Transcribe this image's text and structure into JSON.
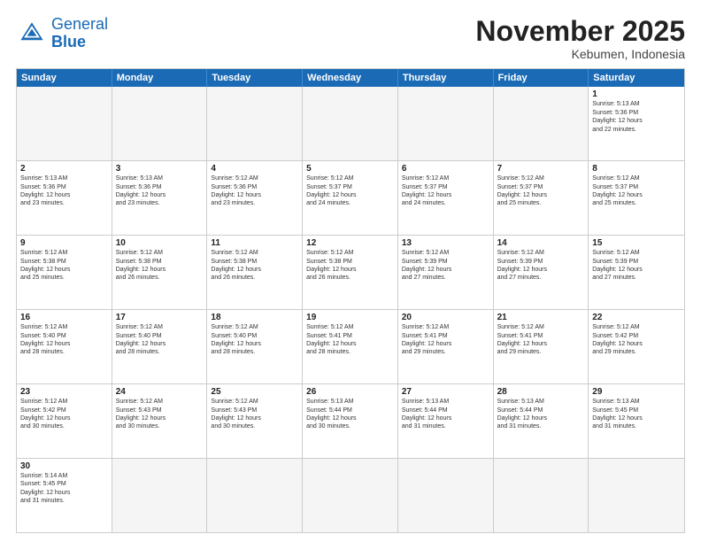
{
  "header": {
    "logo_general": "General",
    "logo_blue": "Blue",
    "title": "November 2025",
    "subtitle": "Kebumen, Indonesia"
  },
  "weekdays": [
    "Sunday",
    "Monday",
    "Tuesday",
    "Wednesday",
    "Thursday",
    "Friday",
    "Saturday"
  ],
  "rows": [
    [
      {
        "day": "",
        "info": "",
        "empty": true
      },
      {
        "day": "",
        "info": "",
        "empty": true
      },
      {
        "day": "",
        "info": "",
        "empty": true
      },
      {
        "day": "",
        "info": "",
        "empty": true
      },
      {
        "day": "",
        "info": "",
        "empty": true
      },
      {
        "day": "",
        "info": "",
        "empty": true
      },
      {
        "day": "1",
        "info": "Sunrise: 5:13 AM\nSunset: 5:36 PM\nDaylight: 12 hours\nand 22 minutes.",
        "empty": false
      }
    ],
    [
      {
        "day": "2",
        "info": "Sunrise: 5:13 AM\nSunset: 5:36 PM\nDaylight: 12 hours\nand 23 minutes.",
        "empty": false
      },
      {
        "day": "3",
        "info": "Sunrise: 5:13 AM\nSunset: 5:36 PM\nDaylight: 12 hours\nand 23 minutes.",
        "empty": false
      },
      {
        "day": "4",
        "info": "Sunrise: 5:12 AM\nSunset: 5:36 PM\nDaylight: 12 hours\nand 23 minutes.",
        "empty": false
      },
      {
        "day": "5",
        "info": "Sunrise: 5:12 AM\nSunset: 5:37 PM\nDaylight: 12 hours\nand 24 minutes.",
        "empty": false
      },
      {
        "day": "6",
        "info": "Sunrise: 5:12 AM\nSunset: 5:37 PM\nDaylight: 12 hours\nand 24 minutes.",
        "empty": false
      },
      {
        "day": "7",
        "info": "Sunrise: 5:12 AM\nSunset: 5:37 PM\nDaylight: 12 hours\nand 25 minutes.",
        "empty": false
      },
      {
        "day": "8",
        "info": "Sunrise: 5:12 AM\nSunset: 5:37 PM\nDaylight: 12 hours\nand 25 minutes.",
        "empty": false
      }
    ],
    [
      {
        "day": "9",
        "info": "Sunrise: 5:12 AM\nSunset: 5:38 PM\nDaylight: 12 hours\nand 25 minutes.",
        "empty": false
      },
      {
        "day": "10",
        "info": "Sunrise: 5:12 AM\nSunset: 5:38 PM\nDaylight: 12 hours\nand 26 minutes.",
        "empty": false
      },
      {
        "day": "11",
        "info": "Sunrise: 5:12 AM\nSunset: 5:38 PM\nDaylight: 12 hours\nand 26 minutes.",
        "empty": false
      },
      {
        "day": "12",
        "info": "Sunrise: 5:12 AM\nSunset: 5:38 PM\nDaylight: 12 hours\nand 26 minutes.",
        "empty": false
      },
      {
        "day": "13",
        "info": "Sunrise: 5:12 AM\nSunset: 5:39 PM\nDaylight: 12 hours\nand 27 minutes.",
        "empty": false
      },
      {
        "day": "14",
        "info": "Sunrise: 5:12 AM\nSunset: 5:39 PM\nDaylight: 12 hours\nand 27 minutes.",
        "empty": false
      },
      {
        "day": "15",
        "info": "Sunrise: 5:12 AM\nSunset: 5:39 PM\nDaylight: 12 hours\nand 27 minutes.",
        "empty": false
      }
    ],
    [
      {
        "day": "16",
        "info": "Sunrise: 5:12 AM\nSunset: 5:40 PM\nDaylight: 12 hours\nand 28 minutes.",
        "empty": false
      },
      {
        "day": "17",
        "info": "Sunrise: 5:12 AM\nSunset: 5:40 PM\nDaylight: 12 hours\nand 28 minutes.",
        "empty": false
      },
      {
        "day": "18",
        "info": "Sunrise: 5:12 AM\nSunset: 5:40 PM\nDaylight: 12 hours\nand 28 minutes.",
        "empty": false
      },
      {
        "day": "19",
        "info": "Sunrise: 5:12 AM\nSunset: 5:41 PM\nDaylight: 12 hours\nand 28 minutes.",
        "empty": false
      },
      {
        "day": "20",
        "info": "Sunrise: 5:12 AM\nSunset: 5:41 PM\nDaylight: 12 hours\nand 29 minutes.",
        "empty": false
      },
      {
        "day": "21",
        "info": "Sunrise: 5:12 AM\nSunset: 5:41 PM\nDaylight: 12 hours\nand 29 minutes.",
        "empty": false
      },
      {
        "day": "22",
        "info": "Sunrise: 5:12 AM\nSunset: 5:42 PM\nDaylight: 12 hours\nand 29 minutes.",
        "empty": false
      }
    ],
    [
      {
        "day": "23",
        "info": "Sunrise: 5:12 AM\nSunset: 5:42 PM\nDaylight: 12 hours\nand 30 minutes.",
        "empty": false
      },
      {
        "day": "24",
        "info": "Sunrise: 5:12 AM\nSunset: 5:43 PM\nDaylight: 12 hours\nand 30 minutes.",
        "empty": false
      },
      {
        "day": "25",
        "info": "Sunrise: 5:12 AM\nSunset: 5:43 PM\nDaylight: 12 hours\nand 30 minutes.",
        "empty": false
      },
      {
        "day": "26",
        "info": "Sunrise: 5:13 AM\nSunset: 5:44 PM\nDaylight: 12 hours\nand 30 minutes.",
        "empty": false
      },
      {
        "day": "27",
        "info": "Sunrise: 5:13 AM\nSunset: 5:44 PM\nDaylight: 12 hours\nand 31 minutes.",
        "empty": false
      },
      {
        "day": "28",
        "info": "Sunrise: 5:13 AM\nSunset: 5:44 PM\nDaylight: 12 hours\nand 31 minutes.",
        "empty": false
      },
      {
        "day": "29",
        "info": "Sunrise: 5:13 AM\nSunset: 5:45 PM\nDaylight: 12 hours\nand 31 minutes.",
        "empty": false
      }
    ],
    [
      {
        "day": "30",
        "info": "Sunrise: 5:14 AM\nSunset: 5:45 PM\nDaylight: 12 hours\nand 31 minutes.",
        "empty": false
      },
      {
        "day": "",
        "info": "",
        "empty": true
      },
      {
        "day": "",
        "info": "",
        "empty": true
      },
      {
        "day": "",
        "info": "",
        "empty": true
      },
      {
        "day": "",
        "info": "",
        "empty": true
      },
      {
        "day": "",
        "info": "",
        "empty": true
      },
      {
        "day": "",
        "info": "",
        "empty": true
      }
    ]
  ]
}
